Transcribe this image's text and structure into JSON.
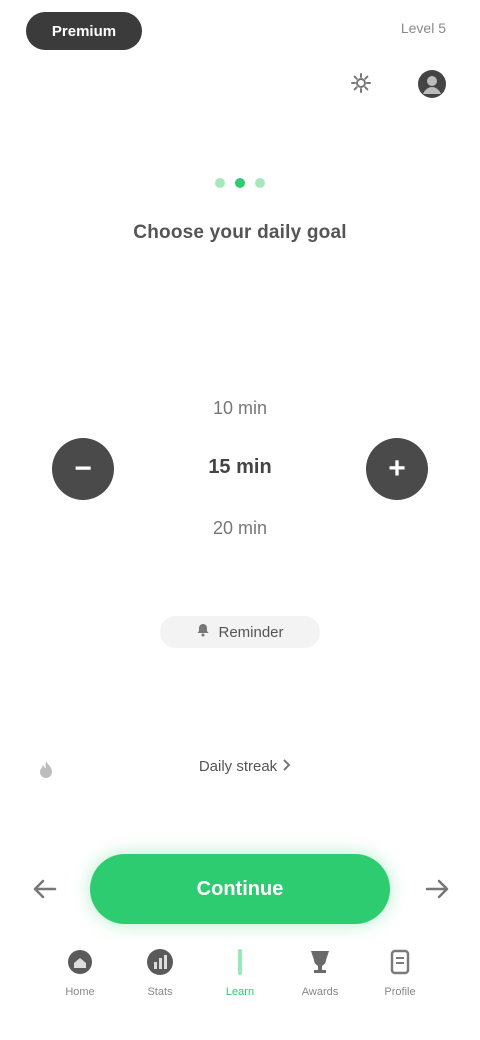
{
  "top_bar": {
    "badge_label": "Premium",
    "status_text": "Level 5"
  },
  "header": {
    "headline": "Choose your daily goal"
  },
  "picker": {
    "decrement_symbol": "−",
    "increment_symbol": "+",
    "options": [
      "10 min",
      "15 min",
      "20 min"
    ]
  },
  "tag_chip": {
    "label": "Reminder"
  },
  "info_row": {
    "label": "Daily streak"
  },
  "cta": {
    "label": "Continue"
  },
  "bottom_nav": {
    "items": [
      {
        "label": "Home",
        "icon": "home-icon"
      },
      {
        "label": "Stats",
        "icon": "stats-icon"
      },
      {
        "label": "Learn",
        "icon": "learn-icon"
      },
      {
        "label": "Awards",
        "icon": "award-icon"
      },
      {
        "label": "Profile",
        "icon": "profile-icon"
      }
    ],
    "active_index": 2
  },
  "colors": {
    "accent": "#2ecc71",
    "accent_light": "#a8e6bd",
    "dark": "#3b3b3b"
  }
}
